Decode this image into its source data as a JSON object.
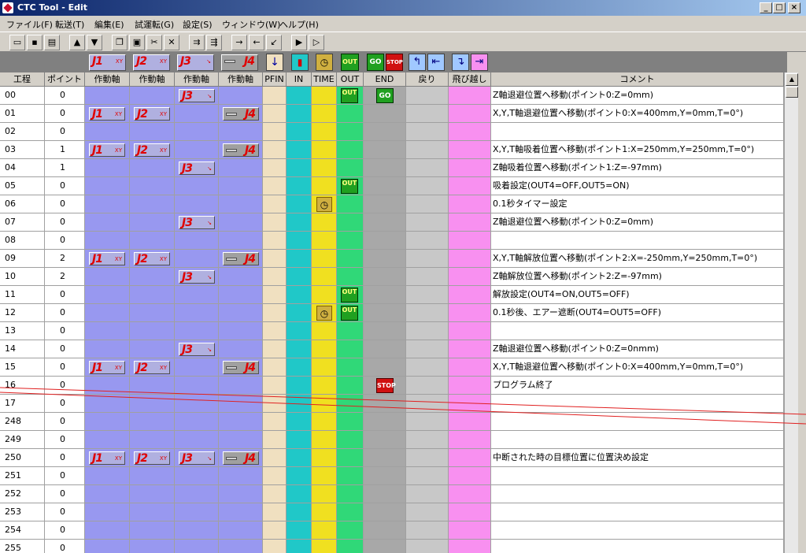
{
  "window": {
    "title": "CTC Tool - Edit"
  },
  "menu": [
    "ファイル(F)",
    "転送(T)",
    "編集(E)",
    "試運転(G)",
    "設定(S)",
    "ウィンドウ(W)",
    "ヘルプ(H)"
  ],
  "icon_labels": {
    "j1": "J1",
    "j2": "J2",
    "j3": "J3",
    "j4": "J4",
    "xy": "XY",
    "out": "OUT",
    "go": "GO",
    "stop": "STOP"
  },
  "columns": [
    "工程",
    "ポイント",
    "作動軸",
    "作動軸",
    "作動軸",
    "作動軸",
    "PFIN",
    "IN",
    "TIME",
    "OUT",
    "END",
    "戻り",
    "飛び越し",
    "コメント"
  ],
  "toolbar_icons": [
    "open-icon",
    "save-icon",
    "print-icon",
    "move-up-icon",
    "move-down-icon",
    "copy-icon",
    "paste-icon",
    "cut-icon",
    "delete-icon",
    "insert-row-icon",
    "append-row-icon",
    "indent-icon",
    "outdent-icon",
    "unindent-icon",
    "run-icon",
    "step-icon"
  ],
  "rows": [
    {
      "step": "00",
      "point": "0",
      "j1": false,
      "j2": false,
      "j3": true,
      "j4": false,
      "time": false,
      "out": true,
      "end": "go",
      "comment": "Z軸退避位置へ移動(ポイント0:Z=0mm)"
    },
    {
      "step": "01",
      "point": "0",
      "j1": true,
      "j2": true,
      "j3": false,
      "j4": true,
      "time": false,
      "out": false,
      "end": "",
      "comment": "X,Y,T軸退避位置へ移動(ポイント0:X=400mm,Y=0mm,T=0°)"
    },
    {
      "step": "02",
      "point": "0",
      "j1": false,
      "j2": false,
      "j3": false,
      "j4": false,
      "time": false,
      "out": false,
      "end": "",
      "comment": ""
    },
    {
      "step": "03",
      "point": "1",
      "j1": true,
      "j2": true,
      "j3": false,
      "j4": true,
      "time": false,
      "out": false,
      "end": "",
      "comment": "X,Y,T軸吸着位置へ移動(ポイント1:X=250mm,Y=250mm,T=0°)"
    },
    {
      "step": "04",
      "point": "1",
      "j1": false,
      "j2": false,
      "j3": true,
      "j4": false,
      "time": false,
      "out": false,
      "end": "",
      "comment": "Z軸吸着位置へ移動(ポイント1:Z=-97mm)"
    },
    {
      "step": "05",
      "point": "0",
      "j1": false,
      "j2": false,
      "j3": false,
      "j4": false,
      "time": false,
      "out": true,
      "end": "",
      "comment": "吸着設定(OUT4=OFF,OUT5=ON)"
    },
    {
      "step": "06",
      "point": "0",
      "j1": false,
      "j2": false,
      "j3": false,
      "j4": false,
      "time": true,
      "out": false,
      "end": "",
      "comment": "0.1秒タイマー設定"
    },
    {
      "step": "07",
      "point": "0",
      "j1": false,
      "j2": false,
      "j3": true,
      "j4": false,
      "time": false,
      "out": false,
      "end": "",
      "comment": "Z軸退避位置へ移動(ポイント0:Z=0mm)"
    },
    {
      "step": "08",
      "point": "0",
      "j1": false,
      "j2": false,
      "j3": false,
      "j4": false,
      "time": false,
      "out": false,
      "end": "",
      "comment": ""
    },
    {
      "step": "09",
      "point": "2",
      "j1": true,
      "j2": true,
      "j3": false,
      "j4": true,
      "time": false,
      "out": false,
      "end": "",
      "comment": "X,Y,T軸解放位置へ移動(ポイント2:X=-250mm,Y=250mm,T=0°)"
    },
    {
      "step": "10",
      "point": "2",
      "j1": false,
      "j2": false,
      "j3": true,
      "j4": false,
      "time": false,
      "out": false,
      "end": "",
      "comment": "Z軸解放位置へ移動(ポイント2:Z=-97mm)"
    },
    {
      "step": "11",
      "point": "0",
      "j1": false,
      "j2": false,
      "j3": false,
      "j4": false,
      "time": false,
      "out": true,
      "end": "",
      "comment": "解放設定(OUT4=ON,OUT5=OFF)"
    },
    {
      "step": "12",
      "point": "0",
      "j1": false,
      "j2": false,
      "j3": false,
      "j4": false,
      "time": true,
      "out": true,
      "end": "",
      "comment": "0.1秒後、エアー遮断(OUT4=OUT5=OFF)"
    },
    {
      "step": "13",
      "point": "0",
      "j1": false,
      "j2": false,
      "j3": false,
      "j4": false,
      "time": false,
      "out": false,
      "end": "",
      "comment": ""
    },
    {
      "step": "14",
      "point": "0",
      "j1": false,
      "j2": false,
      "j3": true,
      "j4": false,
      "time": false,
      "out": false,
      "end": "",
      "comment": "Z軸退避位置へ移動(ポイント0:Z=0nmm)"
    },
    {
      "step": "15",
      "point": "0",
      "j1": true,
      "j2": true,
      "j3": false,
      "j4": true,
      "time": false,
      "out": false,
      "end": "",
      "comment": "X,Y,T軸退避位置へ移動(ポイント0:X=400mm,Y=0mm,T=0°)"
    },
    {
      "step": "16",
      "point": "0",
      "j1": false,
      "j2": false,
      "j3": false,
      "j4": false,
      "time": false,
      "out": false,
      "end": "stop",
      "comment": "プログラム終了"
    },
    {
      "step": "17",
      "point": "0",
      "j1": false,
      "j2": false,
      "j3": false,
      "j4": false,
      "time": false,
      "out": false,
      "end": "",
      "comment": ""
    },
    {
      "step": "248",
      "point": "0",
      "j1": false,
      "j2": false,
      "j3": false,
      "j4": false,
      "time": false,
      "out": false,
      "end": "",
      "comment": ""
    },
    {
      "step": "249",
      "point": "0",
      "j1": false,
      "j2": false,
      "j3": false,
      "j4": false,
      "time": false,
      "out": false,
      "end": "",
      "comment": ""
    },
    {
      "step": "250",
      "point": "0",
      "j1": true,
      "j2": true,
      "j3": true,
      "j4": true,
      "time": false,
      "out": false,
      "end": "",
      "comment": "中断された時の目標位置に位置決め設定"
    },
    {
      "step": "251",
      "point": "0",
      "j1": false,
      "j2": false,
      "j3": false,
      "j4": false,
      "time": false,
      "out": false,
      "end": "",
      "comment": ""
    },
    {
      "step": "252",
      "point": "0",
      "j1": false,
      "j2": false,
      "j3": false,
      "j4": false,
      "time": false,
      "out": false,
      "end": "",
      "comment": ""
    },
    {
      "step": "253",
      "point": "0",
      "j1": false,
      "j2": false,
      "j3": false,
      "j4": false,
      "time": false,
      "out": false,
      "end": "",
      "comment": ""
    },
    {
      "step": "254",
      "point": "0",
      "j1": false,
      "j2": false,
      "j3": false,
      "j4": false,
      "time": false,
      "out": false,
      "end": "",
      "comment": ""
    },
    {
      "step": "255",
      "point": "0",
      "j1": false,
      "j2": false,
      "j3": false,
      "j4": false,
      "time": false,
      "out": false,
      "end": "",
      "comment": ""
    }
  ]
}
